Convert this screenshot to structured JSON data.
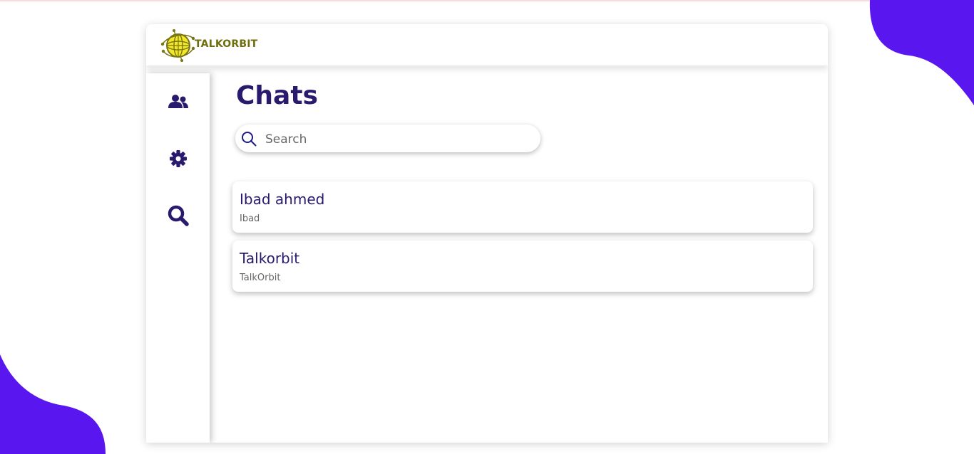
{
  "brand": {
    "name": "TALKORBIT",
    "text_color": "#6e6e0e",
    "icon": "globe-orbit-logo"
  },
  "page": {
    "title": "Chats"
  },
  "search": {
    "placeholder": "Search",
    "value": ""
  },
  "sidebar": {
    "items": [
      {
        "icon": "users-icon"
      },
      {
        "icon": "gear-icon"
      },
      {
        "icon": "search-icon"
      }
    ]
  },
  "chats": [
    {
      "name": "Ibad ahmed",
      "subtitle": "Ibad"
    },
    {
      "name": "Talkorbit",
      "subtitle": "TalkOrbit"
    }
  ],
  "colors": {
    "accent": "#2a1a6e",
    "blob": "#5a16ef",
    "search_icon": "#1b1a8a"
  }
}
